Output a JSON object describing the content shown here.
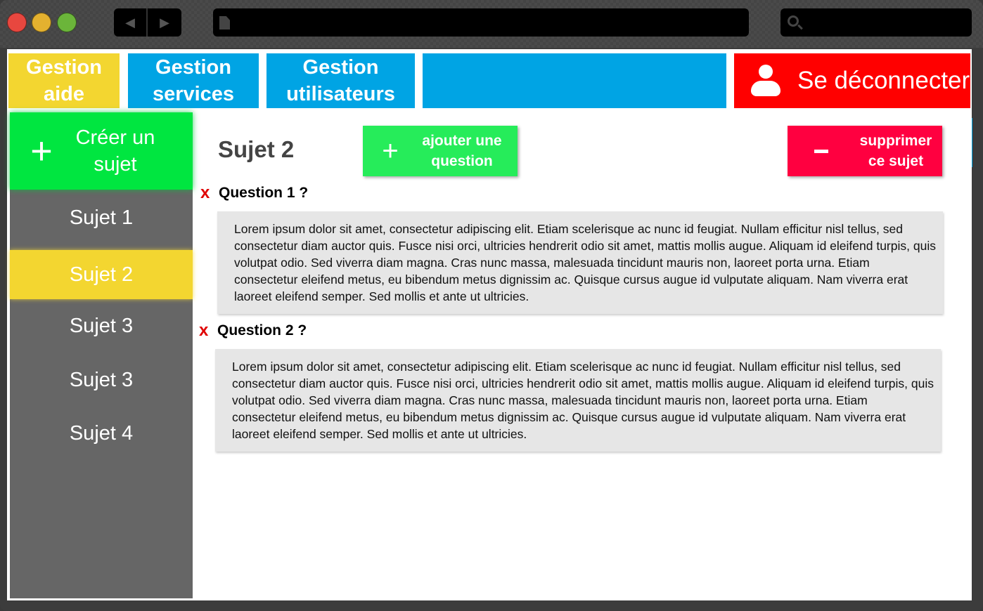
{
  "window": {
    "traffic_lights": [
      "close",
      "minimize",
      "zoom"
    ]
  },
  "toolbar": {
    "back_icon": "back-arrow-icon",
    "forward_icon": "forward-arrow-icon",
    "url": "",
    "search": ""
  },
  "topnav": {
    "tab_aide": "Gestion aide",
    "tab_services": "Gestion services",
    "tab_users": "Gestion utilisateurs",
    "logout": "Se déconnecter",
    "colors": {
      "yellow": "#f3d630",
      "blue": "#00a4e4",
      "red": "#ff0000"
    }
  },
  "sidebar": {
    "create_label": "Créer un sujet",
    "items": [
      {
        "label": "Sujet 1",
        "active": false
      },
      {
        "label": "Sujet 2",
        "active": true
      },
      {
        "label": "Sujet 3",
        "active": false
      },
      {
        "label": "Sujet 3",
        "active": false
      },
      {
        "label": "Sujet 4",
        "active": false
      }
    ]
  },
  "main": {
    "subject_title": "Sujet 2",
    "add_question_label": "ajouter une question",
    "delete_subject_label": "supprimer ce sujet",
    "questions": [
      {
        "delete_mark": "x",
        "title": "Question 1 ?",
        "answer": "Lorem ipsum dolor sit amet, consectetur adipiscing elit. Etiam scelerisque ac nunc id feugiat. Nullam efficitur nisl tellus, sed consectetur diam auctor quis. Fusce nisi orci, ultricies hendrerit odio sit amet, mattis mollis augue. Aliquam id eleifend turpis, quis volutpat odio. Sed viverra diam magna. Cras nunc massa, malesuada tincidunt mauris non, laoreet porta urna. Etiam consectetur eleifend metus, eu bibendum metus dignissim ac. Quisque cursus augue id vulputate aliquam. Nam viverra erat laoreet eleifend semper. Sed mollis et ante ut ultricies."
      },
      {
        "delete_mark": "x",
        "title": "Question 2 ?",
        "answer": "Lorem ipsum dolor sit amet, consectetur adipiscing elit. Etiam scelerisque ac nunc id feugiat. Nullam efficitur nisl tellus, sed consectetur diam auctor quis. Fusce nisi orci, ultricies hendrerit odio sit amet, mattis mollis augue. Aliquam id eleifend turpis, quis volutpat odio. Sed viverra diam magna. Cras nunc massa, malesuada tincidunt mauris non, laoreet porta urna. Etiam consectetur eleifend metus, eu bibendum metus dignissim ac. Quisque cursus augue id vulputate aliquam. Nam viverra erat laoreet eleifend semper. Sed mollis et ante ut ultricies."
      }
    ]
  }
}
